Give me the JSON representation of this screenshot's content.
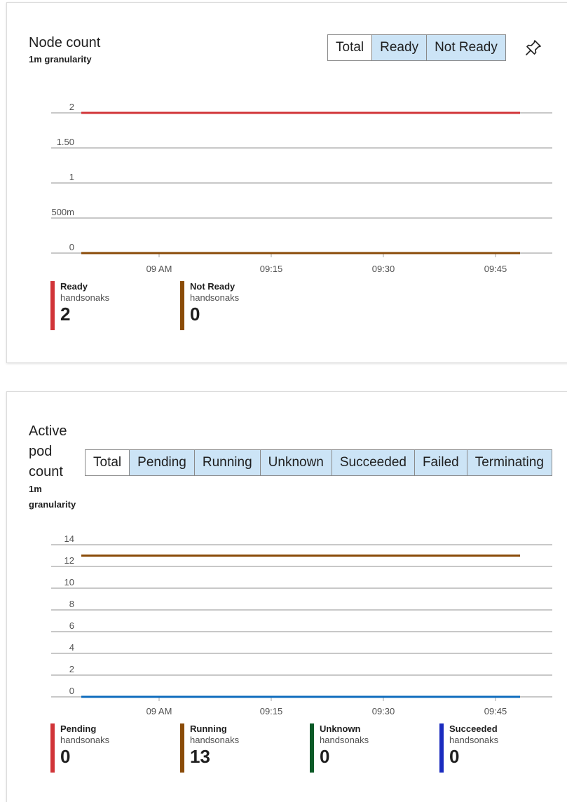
{
  "node_card": {
    "title": "Node count",
    "granularity": "1m granularity",
    "toggles": [
      {
        "label": "Total",
        "active": true
      },
      {
        "label": "Ready",
        "active": false
      },
      {
        "label": "Not Ready",
        "active": false
      }
    ],
    "pin_icon": "pin-icon",
    "legend": [
      {
        "name": "Ready",
        "sub": "handsonaks",
        "value": "2",
        "color": "#d13438"
      },
      {
        "name": "Not Ready",
        "sub": "handsonaks",
        "value": "0",
        "color": "#8a4b08"
      }
    ]
  },
  "pod_card": {
    "title_lines": [
      "Active",
      "pod",
      "count"
    ],
    "granularity_lines": [
      "1m",
      "granularity"
    ],
    "toggles": [
      {
        "label": "Total",
        "active": true
      },
      {
        "label": "Pending",
        "active": false
      },
      {
        "label": "Running",
        "active": false
      },
      {
        "label": "Unknown",
        "active": false
      },
      {
        "label": "Succeeded",
        "active": false
      },
      {
        "label": "Failed",
        "active": false
      },
      {
        "label": "Terminating",
        "active": false
      }
    ],
    "legend": [
      {
        "name": "Pending",
        "sub": "handsonaks",
        "value": "0",
        "color": "#d13438"
      },
      {
        "name": "Running",
        "sub": "handsonaks",
        "value": "13",
        "color": "#8a4b08"
      },
      {
        "name": "Unknown",
        "sub": "handsonaks",
        "value": "0",
        "color": "#0b5a27"
      },
      {
        "name": "Succeeded",
        "sub": "handsonaks",
        "value": "0",
        "color": "#1a2bbf"
      }
    ]
  },
  "chart_data": [
    {
      "type": "line",
      "title": "Node count",
      "x_ticks": [
        "09 AM",
        "09:15",
        "09:30",
        "09:45"
      ],
      "y_ticks": [
        "0",
        "500m",
        "1",
        "1.50",
        "2"
      ],
      "ylim": [
        0,
        2
      ],
      "grid": true,
      "series": [
        {
          "name": "Ready",
          "color": "#d13438",
          "y": [
            2,
            2
          ]
        },
        {
          "name": "Not Ready",
          "color": "#8a4b08",
          "y": [
            0,
            0
          ]
        }
      ]
    },
    {
      "type": "line",
      "title": "Active pod count",
      "x_ticks": [
        "09 AM",
        "09:15",
        "09:30",
        "09:45"
      ],
      "y_ticks": [
        "0",
        "2",
        "4",
        "6",
        "8",
        "10",
        "12",
        "14"
      ],
      "ylim": [
        0,
        14
      ],
      "grid": true,
      "series": [
        {
          "name": "Running",
          "color": "#8a4b08",
          "y": [
            13,
            13
          ]
        },
        {
          "name": "Pending",
          "color": "#0f6cbd",
          "y": [
            0,
            0
          ]
        }
      ]
    }
  ]
}
